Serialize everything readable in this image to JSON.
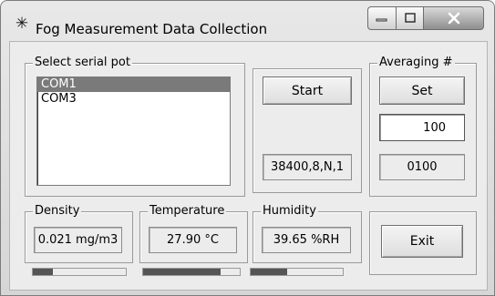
{
  "window": {
    "title": "Fog Measurement Data Collection",
    "icon": "asterisk-icon"
  },
  "serial": {
    "legend": "Select serial pot",
    "ports": [
      "COM1",
      "COM3"
    ],
    "selected": 0
  },
  "start": {
    "label": "Start",
    "settings": "38400,8,N,1"
  },
  "averaging": {
    "legend": "Averaging #",
    "set_label": "Set",
    "input_value": "100",
    "current": "0100"
  },
  "density": {
    "legend": "Density",
    "value": "0.021 mg/m3"
  },
  "temperature": {
    "legend": "Temperature",
    "value": "27.90 °C"
  },
  "humidity": {
    "legend": "Humidity",
    "value": "39.65 %RH"
  },
  "exit": {
    "label": "Exit"
  },
  "colors": {
    "selection": "#7a7a7a",
    "bar_fill": "#555555"
  }
}
